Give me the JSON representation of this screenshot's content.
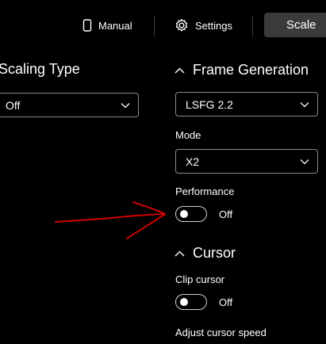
{
  "topbar": {
    "manual_label": "Manual",
    "settings_label": "Settings",
    "scale_label": "Scale"
  },
  "scaling": {
    "heading": "Scaling Type",
    "value": "Off"
  },
  "frame_generation": {
    "heading": "Frame Generation",
    "version_value": "LSFG 2.2",
    "mode_label": "Mode",
    "mode_value": "X2",
    "performance_label": "Performance",
    "performance_state": "Off"
  },
  "cursor": {
    "heading": "Cursor",
    "clip_label": "Clip cursor",
    "clip_state": "Off",
    "adjust_speed_label": "Adjust cursor speed"
  },
  "annotation": {
    "color": "#d00000"
  }
}
